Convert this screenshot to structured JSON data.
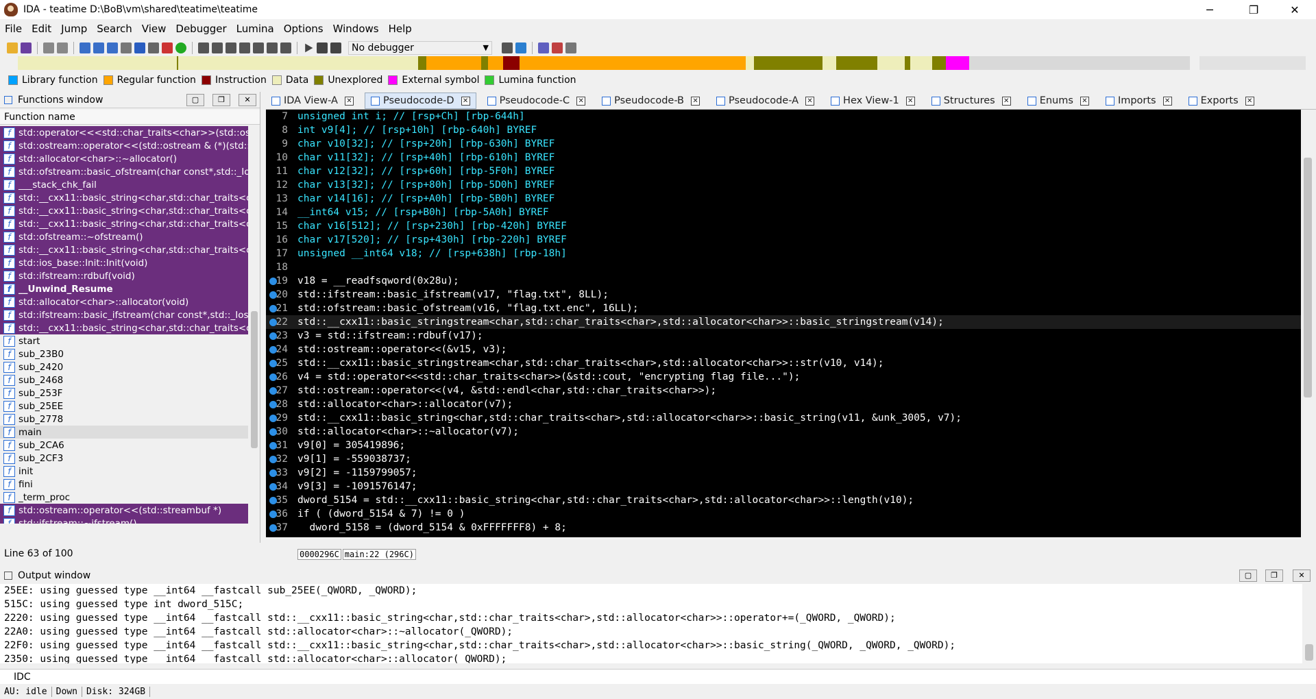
{
  "window": {
    "title": "IDA - teatime D:\\BoB\\vm\\shared\\teatime\\teatime",
    "minimize": "─",
    "maximize": "❐",
    "close": "✕"
  },
  "menu": [
    "File",
    "Edit",
    "Jump",
    "Search",
    "View",
    "Debugger",
    "Lumina",
    "Options",
    "Windows",
    "Help"
  ],
  "toolbar": {
    "debugger": "No debugger"
  },
  "legend": [
    {
      "label": "Library function",
      "color": "#00a2ff"
    },
    {
      "label": "Regular function",
      "color": "#ffa500"
    },
    {
      "label": "Instruction",
      "color": "#8b0000"
    },
    {
      "label": "Data",
      "color": "#eeeebb"
    },
    {
      "label": "Unexplored",
      "color": "#808000"
    },
    {
      "label": "External symbol",
      "color": "#ff00ff"
    },
    {
      "label": "Lumina function",
      "color": "#33cc33"
    }
  ],
  "functions": {
    "title": "Functions window",
    "column": "Function name",
    "rows": [
      {
        "name": "std::operator<<<std::char_traits<char>>(std::ostr",
        "kind": "lib"
      },
      {
        "name": "std::ostream::operator<<(std::ostream & (*)(std::",
        "kind": "lib"
      },
      {
        "name": "std::allocator<char>::~allocator()",
        "kind": "lib"
      },
      {
        "name": "std::ofstream::basic_ofstream(char const*,std::_Io",
        "kind": "lib"
      },
      {
        "name": "___stack_chk_fail",
        "kind": "lib"
      },
      {
        "name": "std::__cxx11::basic_string<char,std::char_traits<c",
        "kind": "lib"
      },
      {
        "name": "std::__cxx11::basic_string<char,std::char_traits<c",
        "kind": "lib"
      },
      {
        "name": "std::__cxx11::basic_string<char,std::char_traits<c",
        "kind": "lib"
      },
      {
        "name": "std::ofstream::~ofstream()",
        "kind": "lib"
      },
      {
        "name": "std::__cxx11::basic_string<char,std::char_traits<c",
        "kind": "lib"
      },
      {
        "name": "std::ios_base::Init::Init(void)",
        "kind": "lib"
      },
      {
        "name": "std::ifstream::rdbuf(void)",
        "kind": "lib"
      },
      {
        "name": "__Unwind_Resume",
        "kind": "libbold"
      },
      {
        "name": "std::allocator<char>::allocator(void)",
        "kind": "lib"
      },
      {
        "name": "std::ifstream::basic_ifstream(char const*,std::_Ios",
        "kind": "lib"
      },
      {
        "name": "std::__cxx11::basic_string<char,std::char_traits<c",
        "kind": "lib"
      },
      {
        "name": "start",
        "kind": "reg"
      },
      {
        "name": "sub_23B0",
        "kind": "reg"
      },
      {
        "name": "sub_2420",
        "kind": "reg"
      },
      {
        "name": "sub_2468",
        "kind": "reg"
      },
      {
        "name": "sub_253F",
        "kind": "reg"
      },
      {
        "name": "sub_25EE",
        "kind": "reg"
      },
      {
        "name": "sub_2778",
        "kind": "reg"
      },
      {
        "name": "main",
        "kind": "sel"
      },
      {
        "name": "sub_2CA6",
        "kind": "reg"
      },
      {
        "name": "sub_2CF3",
        "kind": "reg"
      },
      {
        "name": "init",
        "kind": "reg"
      },
      {
        "name": "fini",
        "kind": "reg"
      },
      {
        "name": "_term_proc",
        "kind": "reg"
      },
      {
        "name": "std::ostream::operator<<(std::streambuf *)",
        "kind": "lib"
      },
      {
        "name": "std::ifstream::~ifstream()",
        "kind": "lib"
      }
    ],
    "line_info": "Line 63 of 100"
  },
  "tabs": [
    {
      "label": "IDA View-A",
      "active": false
    },
    {
      "label": "Pseudocode-D",
      "active": true
    },
    {
      "label": "Pseudocode-C",
      "active": false
    },
    {
      "label": "Pseudocode-B",
      "active": false
    },
    {
      "label": "Pseudocode-A",
      "active": false
    },
    {
      "label": "Hex View-1",
      "active": false
    },
    {
      "label": "Structures",
      "active": false
    },
    {
      "label": "Enums",
      "active": false
    },
    {
      "label": "Imports",
      "active": false
    },
    {
      "label": "Exports",
      "active": false
    }
  ],
  "code": [
    {
      "n": "7",
      "t": "unsigned int i; // [rsp+Ch] [rbp-644h]",
      "dot": false,
      "var": true
    },
    {
      "n": "8",
      "t": "int v9[4]; // [rsp+10h] [rbp-640h] BYREF",
      "dot": false,
      "var": true
    },
    {
      "n": "9",
      "t": "char v10[32]; // [rsp+20h] [rbp-630h] BYREF",
      "dot": false,
      "var": true
    },
    {
      "n": "10",
      "t": "char v11[32]; // [rsp+40h] [rbp-610h] BYREF",
      "dot": false,
      "var": true
    },
    {
      "n": "11",
      "t": "char v12[32]; // [rsp+60h] [rbp-5F0h] BYREF",
      "dot": false,
      "var": true
    },
    {
      "n": "12",
      "t": "char v13[32]; // [rsp+80h] [rbp-5D0h] BYREF",
      "dot": false,
      "var": true
    },
    {
      "n": "13",
      "t": "char v14[16]; // [rsp+A0h] [rbp-5B0h] BYREF",
      "dot": false,
      "var": true
    },
    {
      "n": "14",
      "t": "__int64 v15; // [rsp+B0h] [rbp-5A0h] BYREF",
      "dot": false,
      "var": true
    },
    {
      "n": "15",
      "t": "char v16[512]; // [rsp+230h] [rbp-420h] BYREF",
      "dot": false,
      "var": true
    },
    {
      "n": "16",
      "t": "char v17[520]; // [rsp+430h] [rbp-220h] BYREF",
      "dot": false,
      "var": true
    },
    {
      "n": "17",
      "t": "unsigned __int64 v18; // [rsp+638h] [rbp-18h]",
      "dot": false,
      "var": true
    },
    {
      "n": "18",
      "t": "",
      "dot": false,
      "var": false
    },
    {
      "n": "19",
      "t": "v18 = __readfsqword(0x28u);",
      "dot": true,
      "var": false
    },
    {
      "n": "20",
      "t": "std::ifstream::basic_ifstream(v17, \"flag.txt\", 8LL);",
      "dot": true,
      "var": false
    },
    {
      "n": "21",
      "t": "std::ofstream::basic_ofstream(v16, \"flag.txt.enc\", 16LL);",
      "dot": true,
      "var": false
    },
    {
      "n": "22",
      "t": "std::__cxx11::basic_stringstream<char,std::char_traits<char>,std::allocator<char>>::basic_stringstream(v14);",
      "dot": true,
      "var": false,
      "hl": true
    },
    {
      "n": "23",
      "t": "v3 = std::ifstream::rdbuf(v17);",
      "dot": true,
      "var": false
    },
    {
      "n": "24",
      "t": "std::ostream::operator<<(&v15, v3);",
      "dot": true,
      "var": false
    },
    {
      "n": "25",
      "t": "std::__cxx11::basic_stringstream<char,std::char_traits<char>,std::allocator<char>>::str(v10, v14);",
      "dot": true,
      "var": false
    },
    {
      "n": "26",
      "t": "v4 = std::operator<<<std::char_traits<char>>(&std::cout, \"encrypting flag file...\");",
      "dot": true,
      "var": false
    },
    {
      "n": "27",
      "t": "std::ostream::operator<<(v4, &std::endl<char,std::char_traits<char>>);",
      "dot": true,
      "var": false
    },
    {
      "n": "28",
      "t": "std::allocator<char>::allocator(v7);",
      "dot": true,
      "var": false
    },
    {
      "n": "29",
      "t": "std::__cxx11::basic_string<char,std::char_traits<char>,std::allocator<char>>::basic_string(v11, &unk_3005, v7);",
      "dot": true,
      "var": false
    },
    {
      "n": "30",
      "t": "std::allocator<char>::~allocator(v7);",
      "dot": true,
      "var": false
    },
    {
      "n": "31",
      "t": "v9[0] = 305419896;",
      "dot": true,
      "var": false
    },
    {
      "n": "32",
      "t": "v9[1] = -559038737;",
      "dot": true,
      "var": false
    },
    {
      "n": "33",
      "t": "v9[2] = -1159799057;",
      "dot": true,
      "var": false
    },
    {
      "n": "34",
      "t": "v9[3] = -1091576147;",
      "dot": true,
      "var": false
    },
    {
      "n": "35",
      "t": "dword_5154 = std::__cxx11::basic_string<char,std::char_traits<char>,std::allocator<char>>::length(v10);",
      "dot": true,
      "var": false
    },
    {
      "n": "36",
      "t": "if ( (dword_5154 & 7) != 0 )",
      "dot": true,
      "var": false
    },
    {
      "n": "37",
      "t": "  dword_5158 = (dword_5154 & 0xFFFFFFF8) + 8;",
      "dot": true,
      "var": false
    }
  ],
  "code_status": {
    "addr": "0000296C",
    "loc": "main:22 (296C)"
  },
  "output": {
    "title": "Output window",
    "lines": [
      "25EE: using guessed type __int64 __fastcall sub_25EE(_QWORD, _QWORD);",
      "515C: using guessed type int dword_515C;",
      "2220: using guessed type __int64 __fastcall std::__cxx11::basic_string<char,std::char_traits<char>,std::allocator<char>>::operator+=(_QWORD, _QWORD);",
      "22A0: using guessed type __int64 __fastcall std::allocator<char>::~allocator(_QWORD);",
      "22F0: using guessed type __int64 __fastcall std::__cxx11::basic_string<char,std::char_traits<char>,std::allocator<char>>::basic_string(_QWORD, _QWORD, _QWORD);",
      "2350: using guessed type __int64 __fastcall std::allocator<char>::allocator(_QWORD);"
    ]
  },
  "idc": "IDC",
  "status": {
    "au": "AU:  idle",
    "dir": "Down",
    "disk": "Disk: 324GB"
  }
}
